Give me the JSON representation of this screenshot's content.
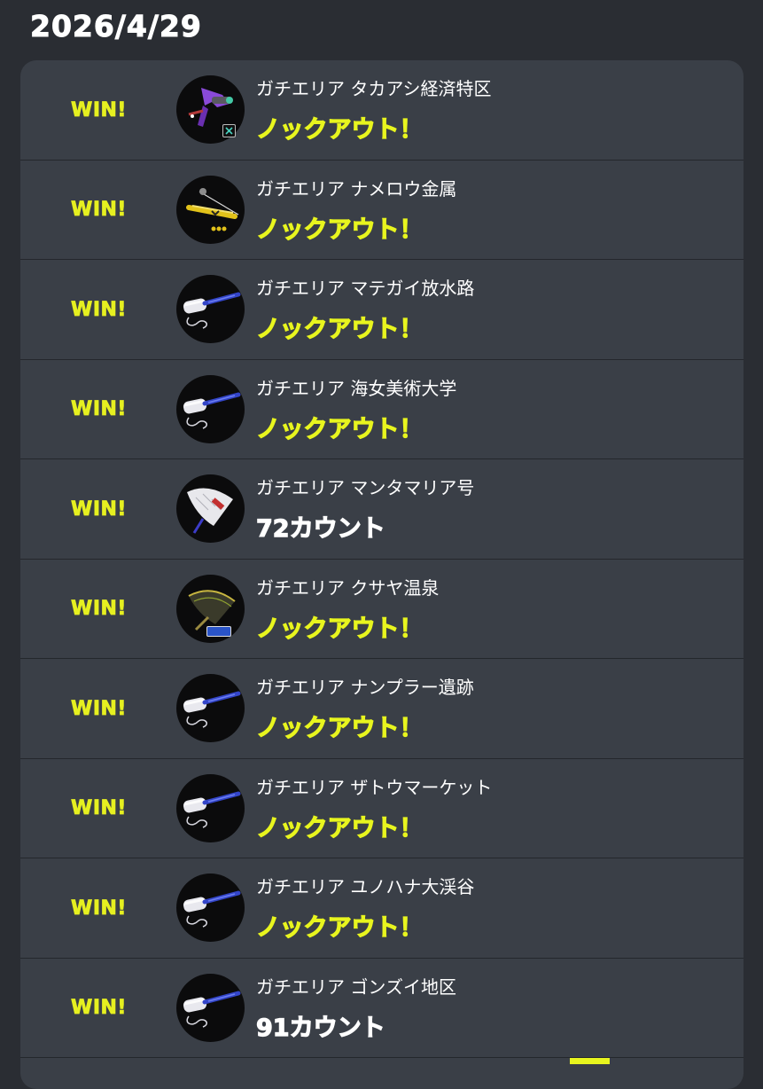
{
  "header": {
    "date": "2026/4/29"
  },
  "battles": [
    {
      "result": "WIN!",
      "mode": "ガチエリア",
      "stage": "タカアシ経済特区",
      "outcome": "ノックアウト！",
      "outcome_type": "ko",
      "weapon_icon": "purple-splattershot-icon",
      "badge": "x"
    },
    {
      "result": "WIN!",
      "mode": "ガチエリア",
      "stage": "ナメロウ金属",
      "outcome": "ノックアウト！",
      "outcome_type": "ko",
      "weapon_icon": "yellow-stringer-icon",
      "badge": ""
    },
    {
      "result": "WIN!",
      "mode": "ガチエリア",
      "stage": "マテガイ放水路",
      "outcome": "ノックアウト！",
      "outcome_type": "ko",
      "weapon_icon": "blue-roller-icon",
      "badge": ""
    },
    {
      "result": "WIN!",
      "mode": "ガチエリア",
      "stage": "海女美術大学",
      "outcome": "ノックアウト！",
      "outcome_type": "ko",
      "weapon_icon": "blue-roller-icon",
      "badge": ""
    },
    {
      "result": "WIN!",
      "mode": "ガチエリア",
      "stage": "マンタマリア号",
      "outcome": "72カウント",
      "outcome_type": "count",
      "weapon_icon": "white-brella-icon",
      "badge": ""
    },
    {
      "result": "WIN!",
      "mode": "ガチエリア",
      "stage": "クサヤ温泉",
      "outcome": "ノックアウト！",
      "outcome_type": "ko",
      "weapon_icon": "dark-brella-icon",
      "badge": "label"
    },
    {
      "result": "WIN!",
      "mode": "ガチエリア",
      "stage": "ナンプラー遺跡",
      "outcome": "ノックアウト！",
      "outcome_type": "ko",
      "weapon_icon": "blue-roller-icon",
      "badge": ""
    },
    {
      "result": "WIN!",
      "mode": "ガチエリア",
      "stage": "ザトウマーケット",
      "outcome": "ノックアウト！",
      "outcome_type": "ko",
      "weapon_icon": "blue-roller-icon",
      "badge": ""
    },
    {
      "result": "WIN!",
      "mode": "ガチエリア",
      "stage": "ユノハナ大渓谷",
      "outcome": "ノックアウト！",
      "outcome_type": "ko",
      "weapon_icon": "blue-roller-icon",
      "badge": ""
    },
    {
      "result": "WIN!",
      "mode": "ガチエリア",
      "stage": "ゴンズイ地区",
      "outcome": "91カウント",
      "outcome_type": "count",
      "weapon_icon": "blue-roller-icon",
      "badge": ""
    }
  ],
  "colors": {
    "win": "#e6f020",
    "ko": "#e8f51e",
    "count": "#ffffff",
    "card": "#3a3f47",
    "page": "#2a2d33"
  }
}
